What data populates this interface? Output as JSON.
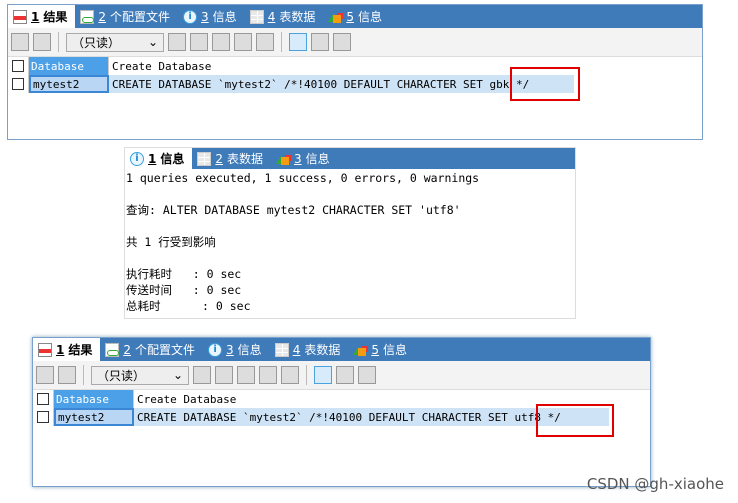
{
  "panel1": {
    "tabs": [
      {
        "num": "1",
        "label": "结果",
        "icon": "results-grid-icon"
      },
      {
        "num": "2",
        "label": "个配置文件",
        "icon": "profile-icon"
      },
      {
        "num": "3",
        "label": "信息",
        "icon": "info-icon"
      },
      {
        "num": "4",
        "label": "表数据",
        "icon": "table-icon"
      },
      {
        "num": "5",
        "label": "信息",
        "icon": "shapes-icon"
      }
    ],
    "select": "（只读）",
    "headers": [
      "Database",
      "Create Database"
    ],
    "row": [
      "mytest2",
      "CREATE DATABASE `mytest2` /*!40100 DEFAULT CHARACTER SET gbk */"
    ]
  },
  "panel2": {
    "tabs": [
      {
        "num": "1",
        "label": "信息"
      },
      {
        "num": "2",
        "label": "表数据"
      },
      {
        "num": "3",
        "label": "信息"
      }
    ],
    "lines": [
      "1 queries executed, 1 success, 0 errors, 0 warnings",
      "",
      "查询: ALTER DATABASE mytest2 CHARACTER SET 'utf8'",
      "",
      "共 1 行受到影响",
      "",
      "执行耗时   : 0 sec",
      "传送时间   : 0 sec",
      "总耗时      : 0 sec"
    ]
  },
  "panel3": {
    "tabs": [
      {
        "num": "1",
        "label": "结果"
      },
      {
        "num": "2",
        "label": "个配置文件"
      },
      {
        "num": "3",
        "label": "信息"
      },
      {
        "num": "4",
        "label": "表数据"
      },
      {
        "num": "5",
        "label": "信息"
      }
    ],
    "select": "（只读）",
    "headers": [
      "Database",
      "Create Database"
    ],
    "row": [
      "mytest2",
      "CREATE DATABASE `mytest2` /*!40100 DEFAULT CHARACTER SET utf8 */"
    ]
  },
  "watermark": "CSDN @gh-xiaohe",
  "colors": {
    "tabbar": "#3f7ab9",
    "highlight": "#e00000"
  }
}
